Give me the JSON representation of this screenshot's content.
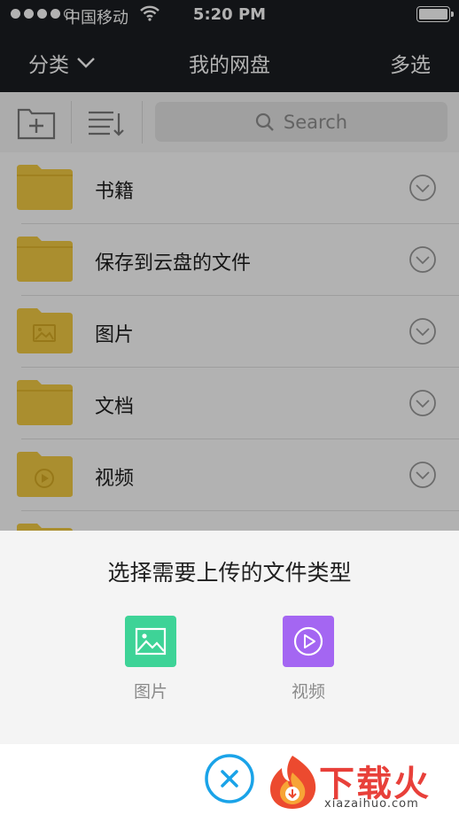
{
  "status_bar": {
    "carrier": "中国移动",
    "time": "5:20 PM"
  },
  "nav": {
    "left_label": "分类",
    "title": "我的网盘",
    "right_label": "多选"
  },
  "search": {
    "placeholder": "Search"
  },
  "folders": [
    {
      "label": "书籍",
      "icon": "folder-icon"
    },
    {
      "label": "保存到云盘的文件",
      "icon": "folder-icon"
    },
    {
      "label": "图片",
      "icon": "folder-image-icon"
    },
    {
      "label": "文档",
      "icon": "folder-icon"
    },
    {
      "label": "视频",
      "icon": "folder-video-icon"
    }
  ],
  "sheet": {
    "title": "选择需要上传的文件类型",
    "options": [
      {
        "label": "图片",
        "color": "#3ed397",
        "icon": "image-icon"
      },
      {
        "label": "视频",
        "color": "#a466f2",
        "icon": "video-play-icon"
      }
    ]
  },
  "watermark": {
    "name": "下载火",
    "domain": "xiazaihuo.com"
  },
  "colors": {
    "navbar": "#1b1d21",
    "folder": "#f4cc44",
    "accent": "#1aa3e8"
  }
}
